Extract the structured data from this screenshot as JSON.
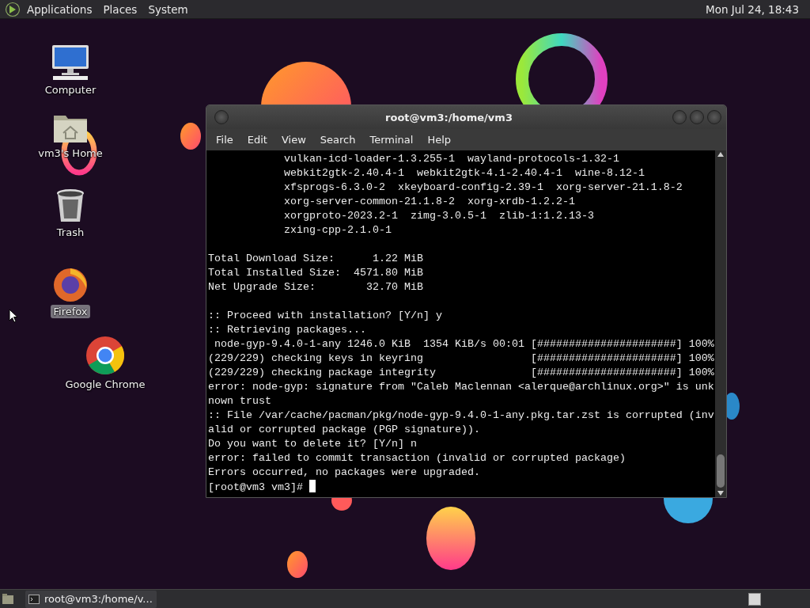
{
  "top_panel": {
    "menus": [
      "Applications",
      "Places",
      "System"
    ],
    "clock": "Mon Jul 24, 18:43"
  },
  "desktop_icons": [
    {
      "label": "Computer",
      "kind": "computer",
      "selected": false
    },
    {
      "label": "vm3's Home",
      "kind": "home",
      "selected": false
    },
    {
      "label": "Trash",
      "kind": "trash",
      "selected": false
    },
    {
      "label": "Firefox",
      "kind": "firefox",
      "selected": true
    },
    {
      "label": "Google Chrome",
      "kind": "chrome",
      "selected": false
    }
  ],
  "terminal": {
    "title": "root@vm3:/home/vm3",
    "menus": [
      "File",
      "Edit",
      "View",
      "Search",
      "Terminal",
      "Help"
    ],
    "blocks": [
      [
        "            vulkan-icd-loader-1.3.255-1  wayland-protocols-1.32-1",
        "            webkit2gtk-2.40.4-1  webkit2gtk-4.1-2.40.4-1  wine-8.12-1",
        "            xfsprogs-6.3.0-2  xkeyboard-config-2.39-1  xorg-server-21.1.8-2",
        "            xorg-server-common-21.1.8-2  xorg-xrdb-1.2.2-1",
        "            xorgproto-2023.2-1  zimg-3.0.5-1  zlib-1:1.2.13-3",
        "            zxing-cpp-2.1.0-1"
      ],
      [
        "Total Download Size:      1.22 MiB",
        "Total Installed Size:  4571.80 MiB",
        "Net Upgrade Size:        32.70 MiB"
      ],
      [
        ":: Proceed with installation? [Y/n] y",
        ":: Retrieving packages...",
        " node-gyp-9.4.0-1-any 1246.0 KiB  1354 KiB/s 00:01 [######################] 100%",
        "(229/229) checking keys in keyring                 [######################] 100%",
        "(229/229) checking package integrity               [######################] 100%",
        "error: node-gyp: signature from \"Caleb Maclennan <alerque@archlinux.org>\" is unk",
        "nown trust",
        ":: File /var/cache/pacman/pkg/node-gyp-9.4.0-1-any.pkg.tar.zst is corrupted (inv",
        "alid or corrupted package (PGP signature)).",
        "Do you want to delete it? [Y/n] n",
        "error: failed to commit transaction (invalid or corrupted package)",
        "Errors occurred, no packages were upgraded."
      ]
    ],
    "prompt": "[root@vm3 vm3]# "
  },
  "taskbar": {
    "tasks": [
      {
        "label": "root@vm3:/home/v...",
        "selected": false
      }
    ]
  }
}
